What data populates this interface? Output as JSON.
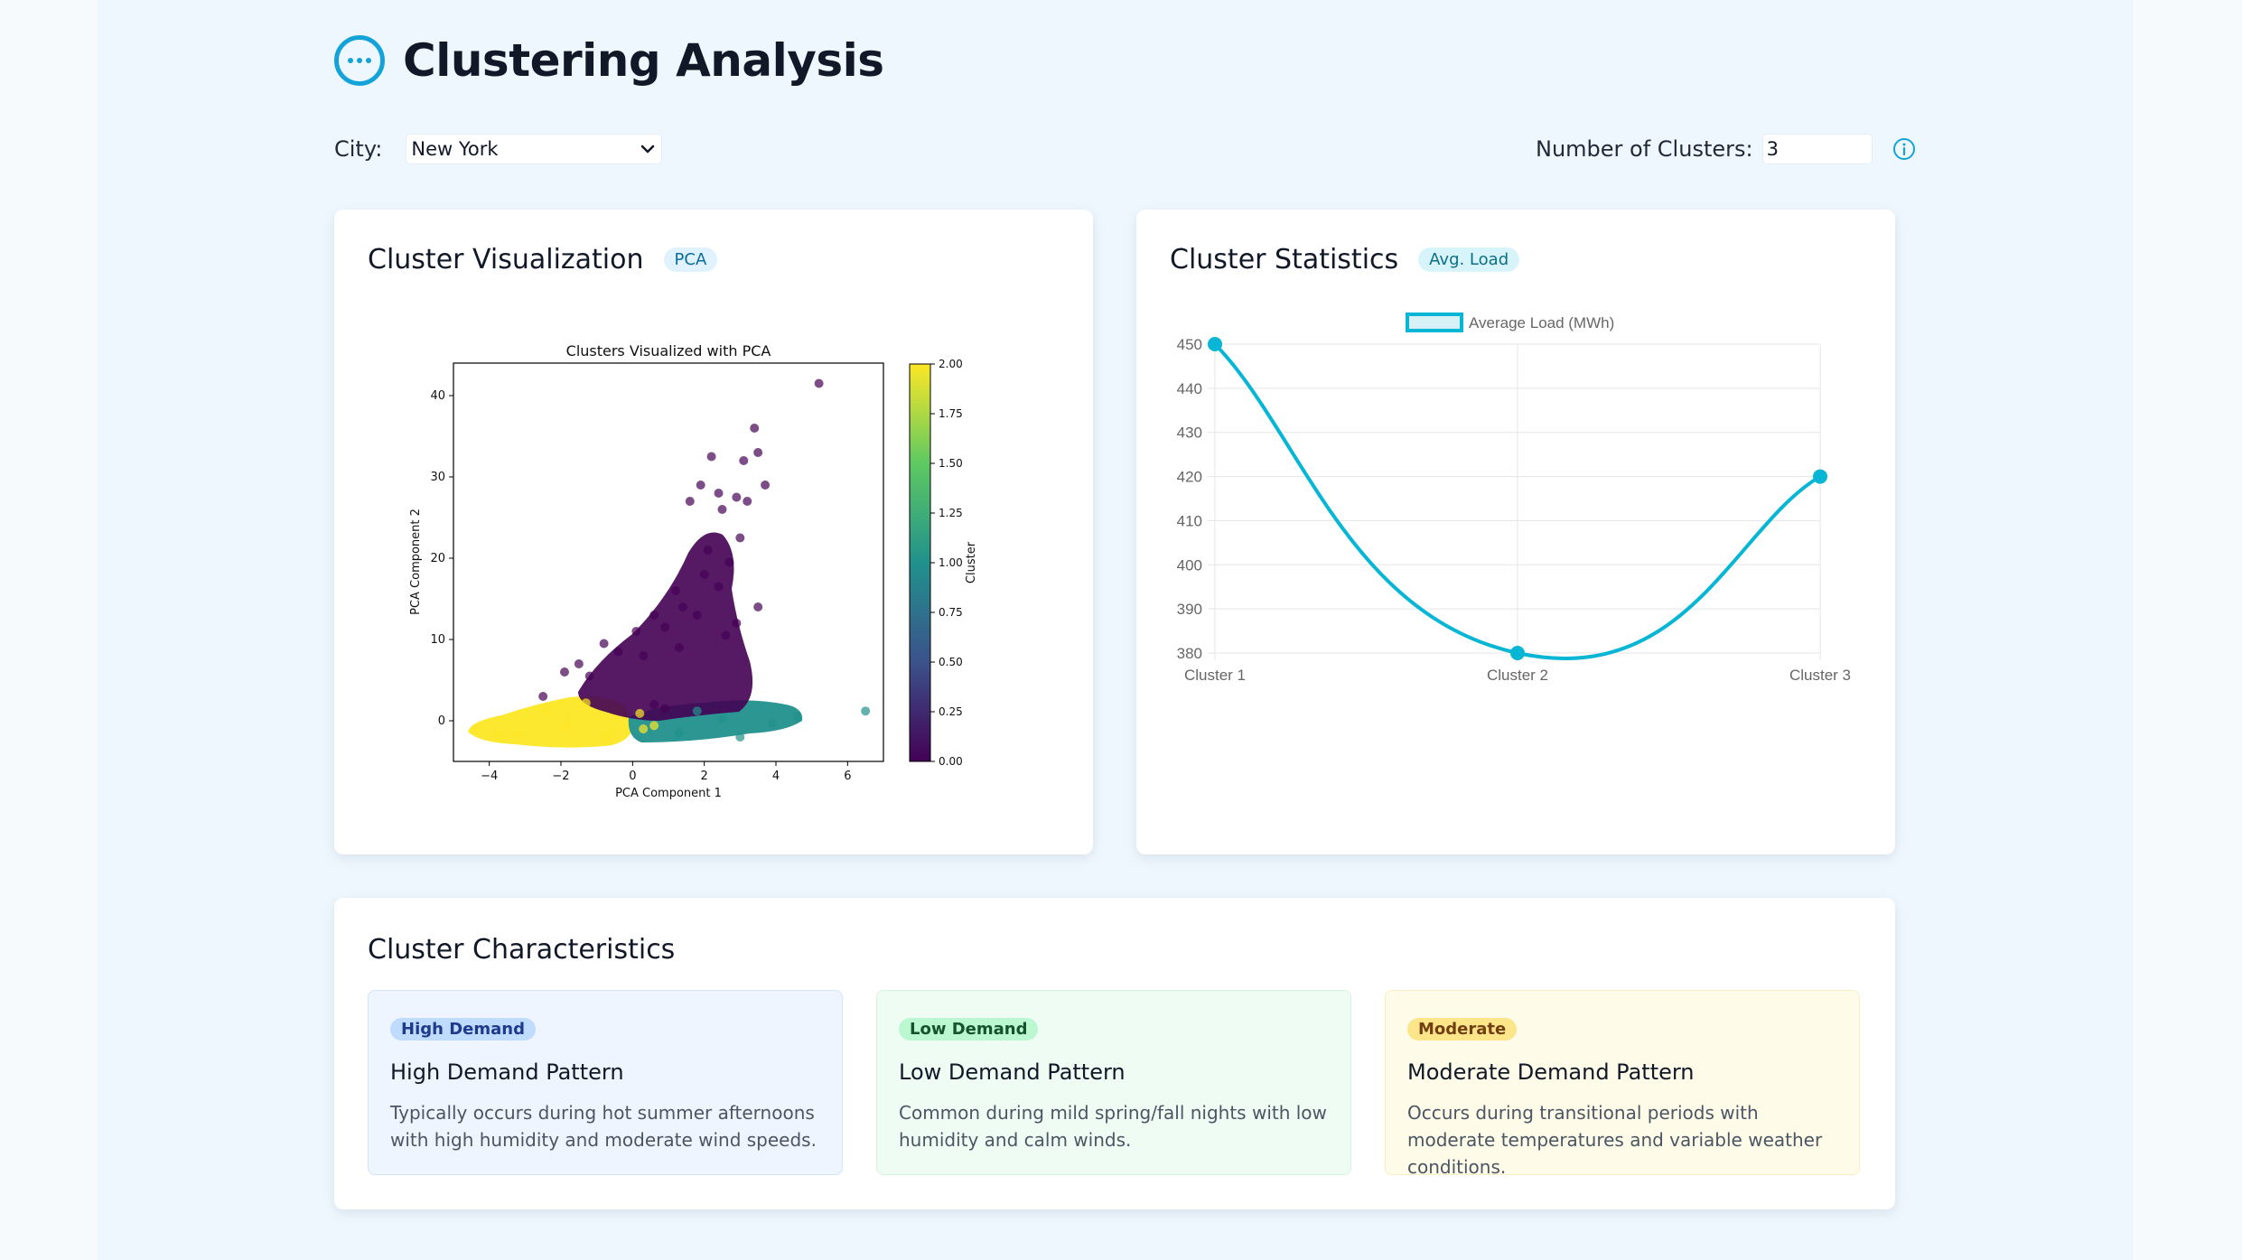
{
  "header": {
    "title": "Clustering Analysis",
    "logo_icon": "more-horizontal-circle-icon"
  },
  "controls": {
    "city_label": "City:",
    "city_value": "New York",
    "clusters_label": "Number of Clusters:",
    "clusters_value": "3",
    "info_icon": "info-icon"
  },
  "colors": {
    "accent": "#14a3d9",
    "line": "#06b6d4",
    "viridis_purple": "#440154",
    "viridis_teal": "#21918c",
    "viridis_yellow": "#fde725"
  },
  "viz_card": {
    "title": "Cluster Visualization",
    "badge": "PCA"
  },
  "stats_card": {
    "title": "Cluster Statistics",
    "badge": "Avg. Load"
  },
  "chart_data": [
    {
      "type": "scatter",
      "title": "Clusters Visualized with PCA",
      "xlabel": "PCA Component 1",
      "ylabel": "PCA Component 2",
      "xlim": [
        -5,
        7
      ],
      "ylim": [
        -5,
        44
      ],
      "xticks": [
        "−4",
        "−2",
        "0",
        "2",
        "4",
        "6"
      ],
      "yticks": [
        "0",
        "10",
        "20",
        "30",
        "40"
      ],
      "colorbar": {
        "label": "Cluster",
        "range": [
          0,
          2
        ],
        "ticks": [
          "0.00",
          "0.25",
          "0.50",
          "0.75",
          "1.00",
          "1.25",
          "1.50",
          "1.75",
          "2.00"
        ]
      },
      "series": [
        {
          "cluster": 0,
          "points": [
            [
              5.2,
              41.5
            ],
            [
              3.4,
              36
            ],
            [
              3.5,
              33
            ],
            [
              2.2,
              32.5
            ],
            [
              3.1,
              32
            ],
            [
              3.7,
              29
            ],
            [
              1.9,
              29
            ],
            [
              2.4,
              28
            ],
            [
              2.9,
              27.5
            ],
            [
              3.2,
              27
            ],
            [
              1.6,
              27
            ],
            [
              2.5,
              26
            ],
            [
              3.0,
              22.5
            ],
            [
              2.1,
              21
            ],
            [
              2.7,
              19.5
            ],
            [
              3.5,
              14
            ],
            [
              0.6,
              13
            ],
            [
              1.2,
              16
            ],
            [
              2.0,
              18
            ],
            [
              2.4,
              16.5
            ],
            [
              1.4,
              14
            ],
            [
              1.8,
              13
            ],
            [
              0.9,
              11.5
            ],
            [
              2.9,
              12
            ],
            [
              0.1,
              11
            ],
            [
              0.3,
              8
            ],
            [
              -0.4,
              8.5
            ],
            [
              -1.5,
              7
            ],
            [
              -1.9,
              6
            ],
            [
              -1.2,
              5.5
            ],
            [
              -2.5,
              3
            ],
            [
              0.9,
              1.5
            ],
            [
              0.6,
              2
            ],
            [
              1.3,
              9
            ],
            [
              2.6,
              10.5
            ],
            [
              -0.8,
              9.5
            ]
          ]
        },
        {
          "cluster": 1,
          "points": [
            [
              6.5,
              1.2
            ],
            [
              3.9,
              -0.3
            ],
            [
              2.5,
              0.2
            ],
            [
              1.3,
              -1.5
            ],
            [
              4.6,
              0.5
            ],
            [
              3.0,
              -2
            ],
            [
              1.8,
              1.2
            ]
          ]
        },
        {
          "cluster": 2,
          "points": [
            [
              -4.4,
              -1
            ],
            [
              -3.2,
              -1.5
            ],
            [
              -1.8,
              -0.5
            ],
            [
              -0.7,
              -2
            ],
            [
              0.3,
              -1
            ],
            [
              -2.4,
              1.5
            ],
            [
              -1.3,
              2.2
            ],
            [
              0.6,
              -0.6
            ],
            [
              -3.7,
              -1.8
            ],
            [
              0.2,
              0.9
            ]
          ]
        }
      ]
    },
    {
      "type": "line",
      "legend": "Average Load (MWh)",
      "categories": [
        "Cluster 1",
        "Cluster 2",
        "Cluster 3"
      ],
      "values": [
        450,
        380,
        420
      ],
      "ylim": [
        380,
        450
      ],
      "yticks": [
        450,
        440,
        430,
        420,
        410,
        400,
        390,
        380
      ]
    }
  ],
  "characteristics": {
    "title": "Cluster Characteristics",
    "patterns": [
      {
        "tag": "High Demand",
        "title": "High Demand Pattern",
        "description": "Typically occurs during hot summer afternoons with high humidity and moderate wind speeds."
      },
      {
        "tag": "Low Demand",
        "title": "Low Demand Pattern",
        "description": "Common during mild spring/fall nights with low humidity and calm winds."
      },
      {
        "tag": "Moderate",
        "title": "Moderate Demand Pattern",
        "description": "Occurs during transitional periods with moderate temperatures and variable weather conditions."
      }
    ]
  }
}
